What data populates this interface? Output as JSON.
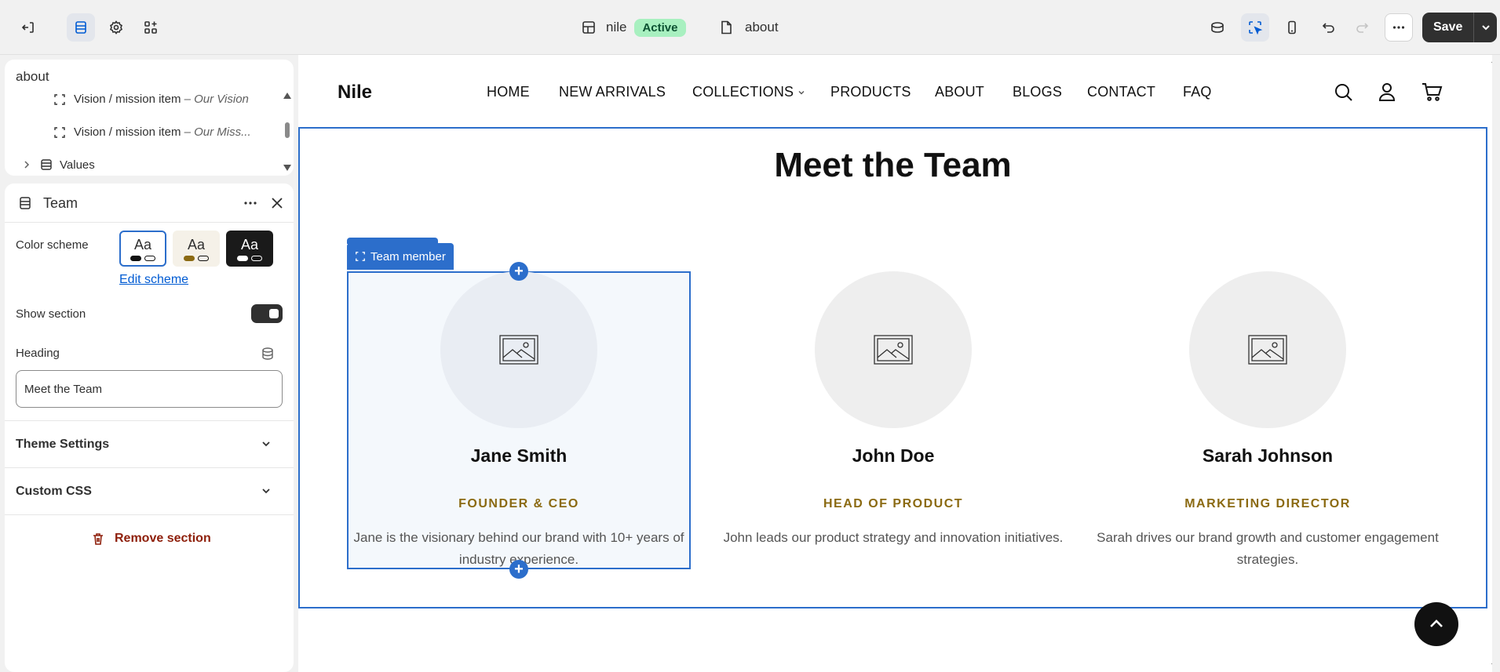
{
  "topbar": {
    "store_name": "nile",
    "store_status": "Active",
    "page_name": "about",
    "save_label": "Save"
  },
  "tree": {
    "title": "about",
    "items": [
      {
        "label": "Vision / mission item",
        "suffix": "– Our Vision"
      },
      {
        "label": "Vision / mission item",
        "suffix": "– Our Miss..."
      },
      {
        "label": "Values",
        "suffix": ""
      }
    ]
  },
  "settings": {
    "section_title": "Team",
    "color_scheme_label": "Color scheme",
    "swatch_text": "Aa",
    "edit_scheme": "Edit scheme",
    "show_section_label": "Show section",
    "heading_label": "Heading",
    "heading_value": "Meet the Team",
    "theme_settings": "Theme Settings",
    "custom_css": "Custom CSS",
    "remove_section": "Remove section"
  },
  "site": {
    "logo": "Nile",
    "nav": [
      "HOME",
      "NEW ARRIVALS",
      "COLLECTIONS",
      "PRODUCTS",
      "ABOUT",
      "BLOGS",
      "CONTACT",
      "FAQ"
    ],
    "section_heading": "Meet the Team",
    "selection_tag": "Team member",
    "members": [
      {
        "name": "Jane Smith",
        "role": "FOUNDER & CEO",
        "desc": "Jane is the visionary behind our brand with 10+ years of industry experience."
      },
      {
        "name": "John Doe",
        "role": "HEAD OF PRODUCT",
        "desc": "John leads our product strategy and innovation initiatives."
      },
      {
        "name": "Sarah Johnson",
        "role": "MARKETING DIRECTOR",
        "desc": "Sarah drives our brand growth and customer engagement strategies."
      }
    ]
  },
  "colors": {
    "accent": "#2c6ecb",
    "role_gold": "#8b6a12",
    "active_badge": "#a8f0c0"
  },
  "icons": [
    "exit-icon",
    "sections-icon",
    "settings-icon",
    "apps-icon",
    "layout-icon",
    "page-icon",
    "inspector-icon",
    "select-icon",
    "mobile-icon",
    "undo-icon",
    "redo-icon",
    "more-icon",
    "chevron-down-icon",
    "search-icon",
    "account-icon",
    "cart-icon",
    "image-placeholder-icon",
    "trash-icon",
    "arrow-up-icon"
  ]
}
